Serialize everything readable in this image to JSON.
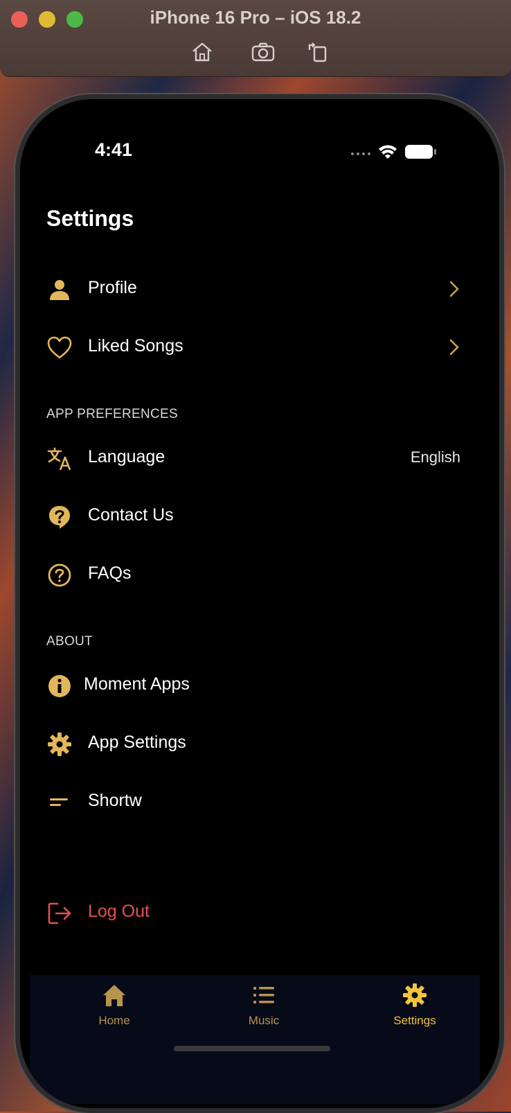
{
  "window": {
    "title": "iPhone 16 Pro – iOS 18.2"
  },
  "status_bar": {
    "time": "4:41"
  },
  "screen": {
    "title": "Settings"
  },
  "menu": {
    "profile": {
      "label": "Profile"
    },
    "liked": {
      "label": "Liked Songs"
    },
    "section_prefs": "APP PREFERENCES",
    "language": {
      "label": "Language",
      "value": "English"
    },
    "contact": {
      "label": "Contact Us"
    },
    "faqs": {
      "label": "FAQs"
    },
    "section_about": "ABOUT",
    "moment": {
      "label": "Moment Apps"
    },
    "app_settings": {
      "label": "App Settings"
    },
    "shortw": {
      "label": "Shortw"
    },
    "logout": {
      "label": "Log Out"
    }
  },
  "tabs": [
    {
      "label": "Home",
      "icon": "home-icon"
    },
    {
      "label": "Music",
      "icon": "list-icon"
    },
    {
      "label": "Settings",
      "icon": "gear-icon"
    }
  ],
  "colors": {
    "accent": "#e2b75a",
    "active_tab": "#f2c33d",
    "inactive_tab": "#b8954e",
    "danger": "#e4524d"
  }
}
